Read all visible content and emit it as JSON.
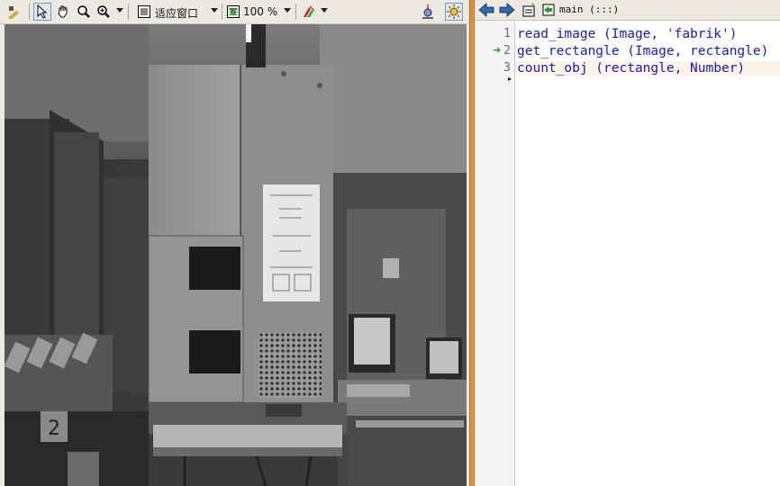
{
  "left_toolbar": {
    "zoom_mode_label": "适应窗口",
    "zoom_percent": "100 %"
  },
  "right_toolbar": {
    "procedure_name": "main (:::)"
  },
  "editor": {
    "lines": [
      {
        "number": "1",
        "code": "read_image (Image, 'fabrik')"
      },
      {
        "number": "2",
        "code": "get_rectangle (Image, rectangle)"
      },
      {
        "number": "3",
        "code": "count_obj (rectangle, Number)"
      }
    ],
    "program_counter_line": 2
  },
  "colors": {
    "divider": "#e0903a",
    "code_text": "#1a1ab0",
    "pc_arrow": "#2a9a2a"
  }
}
